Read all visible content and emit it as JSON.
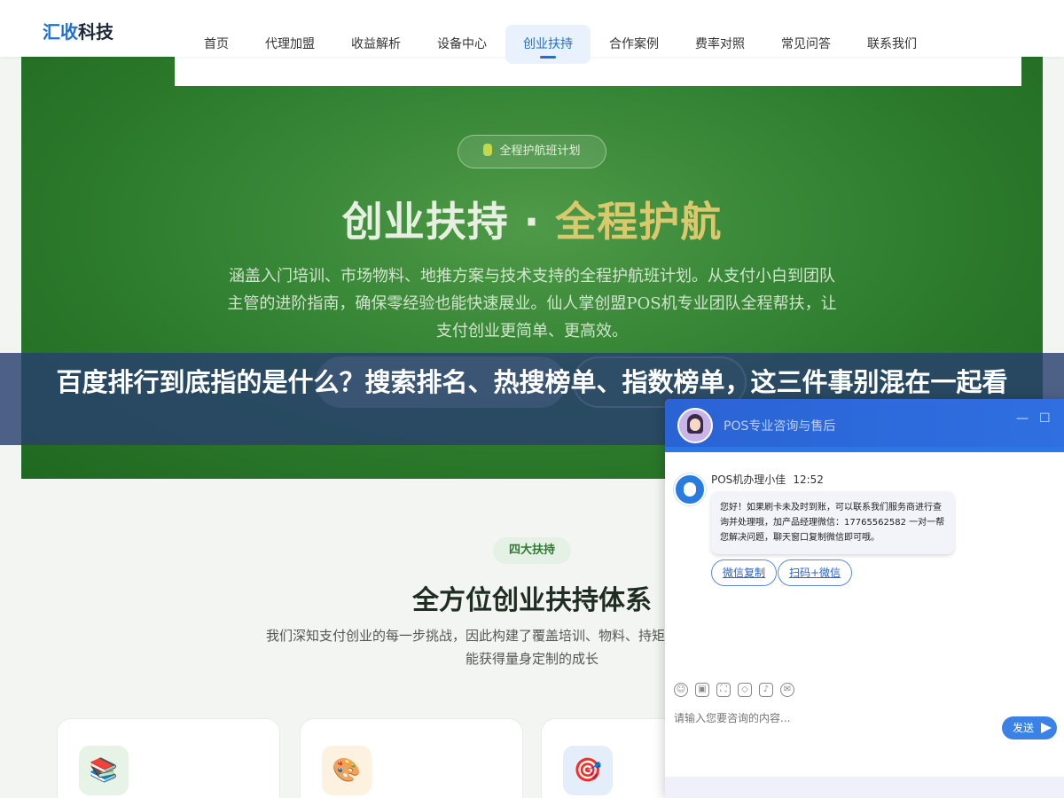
{
  "header": {
    "logo_part1": "汇收",
    "logo_part2": "科技",
    "nav": [
      "首页",
      "代理加盟",
      "收益解析",
      "设备中心",
      "创业扶持",
      "合作案例",
      "费率对照",
      "常见问答",
      "联系我们"
    ],
    "active_nav": "创业扶持"
  },
  "hero": {
    "badge": "全程护航班计划",
    "title_main": "创业扶持 · ",
    "title_accent": "全程护航",
    "desc": "涵盖入门培训、市场物料、地推方案与技术支持的全程护航班计划。从支付小白到团队主管的进阶指南，确保零经验也能快速展业。仙人掌创盟POS机专业团队全程帮扶，让支付创业更简单、更高效。"
  },
  "banner": {
    "text": "百度排行到底指的是什么？搜索排名、热搜榜单、指数榜单，这三件事别混在一起看"
  },
  "section": {
    "badge": "四大扶持",
    "title": "全方位创业扶持体系",
    "desc": "我们深知支付创业的每一步挑战，因此构建了覆盖培训、物料、持矩阵，让每一位代理商都能获得量身定制的成长"
  },
  "cards": [
    {
      "icon": "📚",
      "bg": "#e6f3e6"
    },
    {
      "icon": "🎨",
      "bg": "#fdf1e0"
    },
    {
      "icon": "🎯",
      "bg": "#e4eefa"
    }
  ],
  "chat": {
    "title": "POS专业咨询与售后",
    "minimize": "—",
    "maximize": "☐",
    "agent_name": "POS机办理小佳",
    "time": "12:52",
    "message": "您好！如果刷卡未及时到账，可以联系我们服务商进行查询并处理哦，加产品经理微信：17765562582 一对一帮您解决问题，聊天窗口复制微信即可哦。",
    "quick_buttons": [
      "微信复制",
      "扫码+微信"
    ],
    "input_placeholder": "请输入您要咨询的内容...",
    "send_label": "发送",
    "tools": [
      "☺",
      "▣",
      "⛶",
      "◇",
      "♪",
      "✉"
    ]
  }
}
